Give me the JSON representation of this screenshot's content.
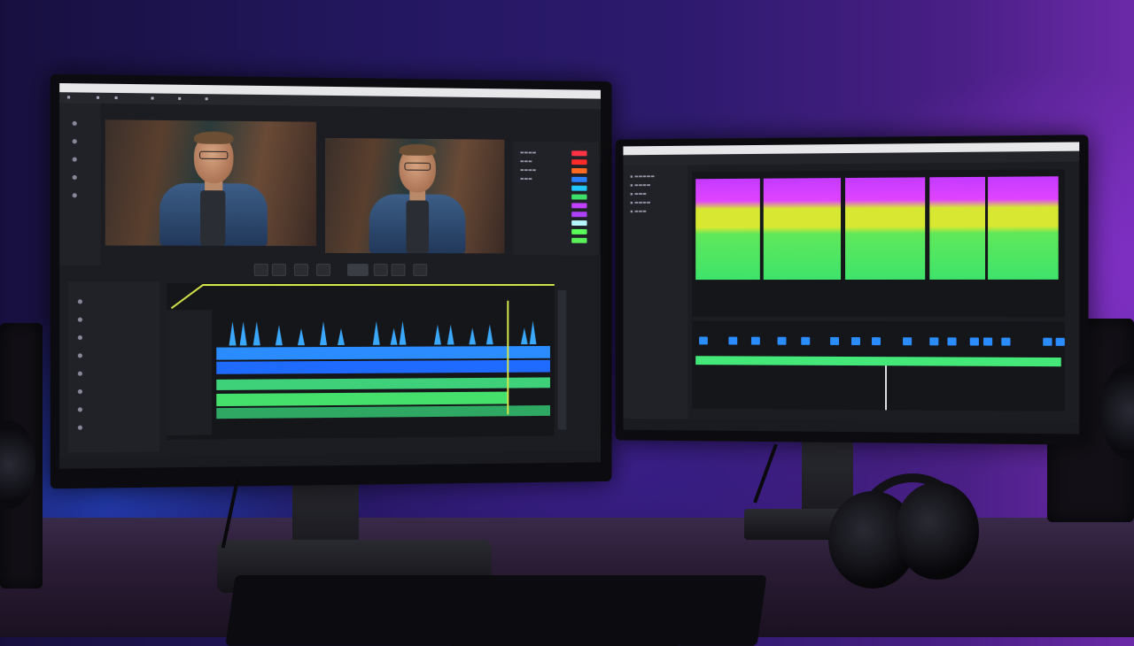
{
  "scene": {
    "description_tags": [
      "dual-monitor",
      "video-editing",
      "audio-editing",
      "desk-setup"
    ]
  },
  "left_monitor": {
    "window_title": "",
    "swatch_colors": [
      "#ff3344",
      "#ff2a2a",
      "#ff6a20",
      "#2a7fff",
      "#22c7ff",
      "#3fe06a",
      "#c040ff",
      "#b040ff",
      "#b7f5ff",
      "#5aff5a",
      "#5af05a"
    ],
    "timeline_colors": {
      "waveform": "#3aa8ff",
      "video_track_1": "#2a8cff",
      "video_track_2": "#1f6bff",
      "audio_track_1": "#3fd07a",
      "audio_track_2": "#45e06c",
      "keyframe_line": "#d7e84a",
      "playhead": "#d7e84a"
    }
  },
  "right_monitor": {
    "window_title": "",
    "audio_band_colors": [
      "#c43aff",
      "#e044ff",
      "#d8e832",
      "#5fe85a",
      "#3ee36b"
    ],
    "track_colors": {
      "clips": "#2a8cff",
      "automation": "#44e878"
    }
  }
}
